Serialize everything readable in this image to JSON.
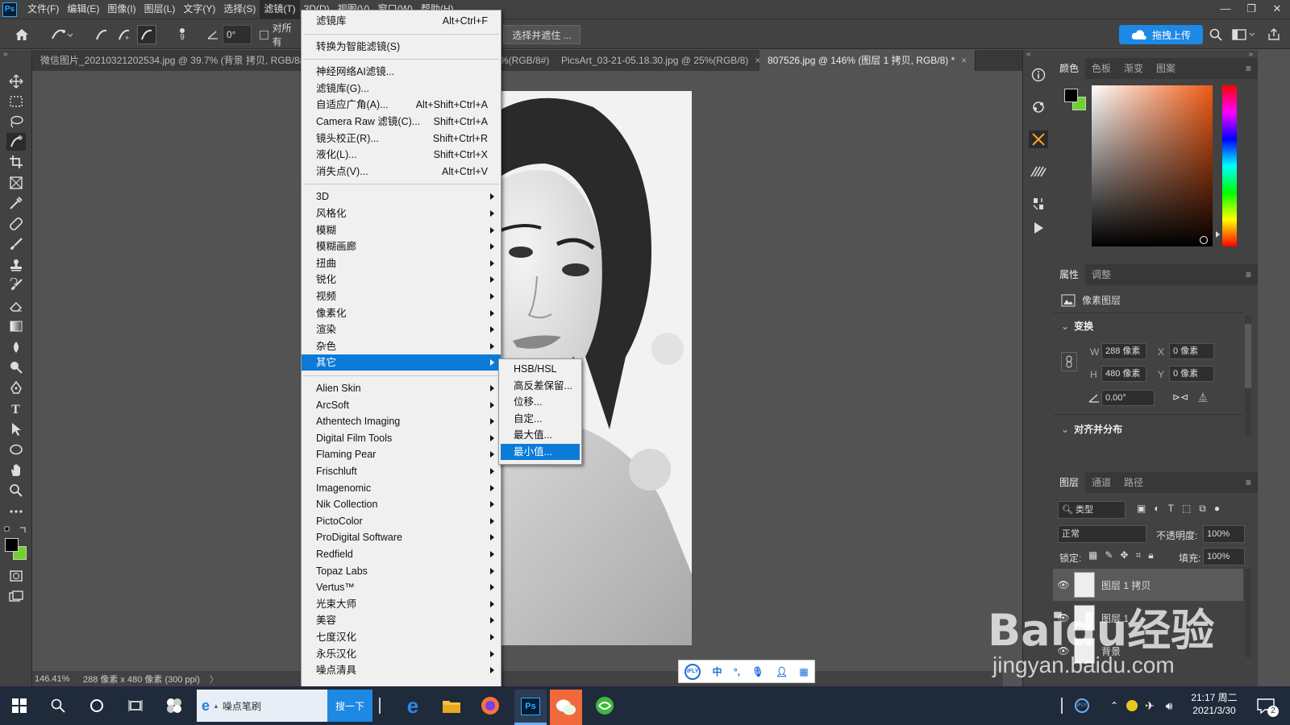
{
  "menubar": {
    "items": [
      "文件(F)",
      "编辑(E)",
      "图像(I)",
      "图层(L)",
      "文字(Y)",
      "选择(S)",
      "滤镜(T)",
      "3D(D)",
      "视图(V)",
      "窗口(W)",
      "帮助(H)"
    ],
    "active_index": 6
  },
  "options_bar": {
    "brush_size": "9",
    "angle": "0°",
    "checkbox_label": "对所有",
    "select_mask_button": "选择并遮住 ...",
    "upload_button": "拖拽上传"
  },
  "tabs": [
    {
      "label": "微信图片_20210321202534.jpg @ 39.7% (背景 拷贝, RGB/8#)",
      "active": false
    },
    {
      "label": "%(RGB/8#)",
      "active": false
    },
    {
      "label": "PicsArt_03-21-05.18.30.jpg @ 25%(RGB/8)",
      "active": false
    },
    {
      "label": "807526.jpg @ 146% (图层 1 拷贝, RGB/8) *",
      "active": true
    }
  ],
  "filter_menu": {
    "group1": [
      {
        "label": "滤镜库",
        "shortcut": "Alt+Ctrl+F"
      }
    ],
    "group2": [
      {
        "label": "转换为智能滤镜(S)",
        "shortcut": ""
      }
    ],
    "group3": [
      {
        "label": "神经网络AI滤镜...",
        "shortcut": ""
      },
      {
        "label": "滤镜库(G)...",
        "shortcut": ""
      },
      {
        "label": "自适应广角(A)...",
        "shortcut": "Alt+Shift+Ctrl+A"
      },
      {
        "label": "Camera Raw 滤镜(C)...",
        "shortcut": "Shift+Ctrl+A"
      },
      {
        "label": "镜头校正(R)...",
        "shortcut": "Shift+Ctrl+R"
      },
      {
        "label": "液化(L)...",
        "shortcut": "Shift+Ctrl+X"
      },
      {
        "label": "消失点(V)...",
        "shortcut": "Alt+Ctrl+V"
      }
    ],
    "group4": [
      "3D",
      "风格化",
      "模糊",
      "模糊画廊",
      "扭曲",
      "锐化",
      "视频",
      "像素化",
      "渲染",
      "杂色",
      "其它"
    ],
    "highlighted": "其它",
    "group5": [
      "Alien Skin",
      "ArcSoft",
      "Athentech Imaging",
      "Digital Film Tools",
      "Flaming Pear",
      "Frischluft",
      "Imagenomic",
      "Nik Collection",
      "PictoColor",
      "ProDigital Software",
      "Redfield",
      "Topaz Labs",
      "Vertus™",
      "光束大师",
      "美容",
      "七度汉化",
      "永乐汉化",
      "噪点清具"
    ]
  },
  "submenu": {
    "items": [
      "HSB/HSL",
      "高反差保留...",
      "位移...",
      "自定...",
      "最大值...",
      "最小值..."
    ],
    "highlighted": "最小值..."
  },
  "status": {
    "zoom": "146.41%",
    "doc_info": "288 像素 x 480 像素 (300 ppi)"
  },
  "color_panel": {
    "tabs": [
      "颜色",
      "色板",
      "渐变",
      "图案"
    ],
    "foreground": "#000000",
    "background": "#6fd12c"
  },
  "properties_panel": {
    "tabs": [
      "属性",
      "调整"
    ],
    "layer_type": "像素图层",
    "section_transform": "变换",
    "w": "288 像素",
    "h": "480 像素",
    "x": "0 像素",
    "y": "0 像素",
    "angle": "0.00°",
    "section_align": "对齐并分布",
    "label_w": "W",
    "label_h": "H",
    "label_x": "X",
    "label_y": "Y"
  },
  "layers_panel": {
    "tabs": [
      "图层",
      "通道",
      "路径"
    ],
    "filter_type": "类型",
    "blend_mode": "正常",
    "opacity_label": "不透明度:",
    "opacity": "100%",
    "lock_label": "锁定:",
    "fill_label": "填充:",
    "fill": "100%",
    "layers": [
      {
        "name": "图层 1 拷贝",
        "selected": true
      },
      {
        "name": "图层 1",
        "selected": false
      },
      {
        "name": "背景",
        "selected": false
      }
    ]
  },
  "taskbar": {
    "search_text": "噪点笔刷",
    "search_button": "搜一下",
    "time": "21:17 周二",
    "date": "2021/3/30",
    "notification_count": "2"
  },
  "ifly": {
    "lang": "中"
  },
  "watermark": {
    "brand": "Baidu经验",
    "url": "jingyan.baidu.com"
  }
}
